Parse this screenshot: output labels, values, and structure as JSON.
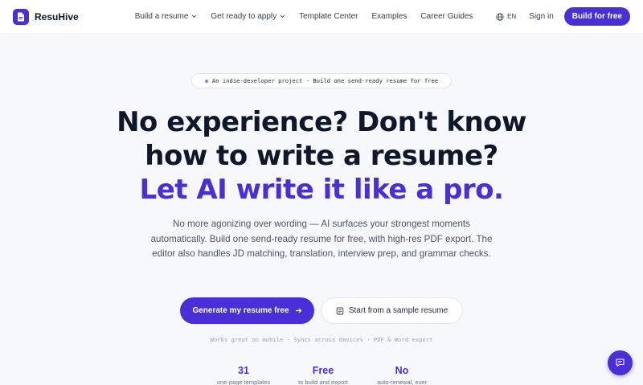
{
  "brand": {
    "name": "ResuHive",
    "logo_icon": "document-icon",
    "accent_color": "#4a2fd8"
  },
  "nav": {
    "items": [
      {
        "label": "Build a resume",
        "has_dropdown": true
      },
      {
        "label": "Get ready to apply",
        "has_dropdown": true
      },
      {
        "label": "Template Center",
        "has_dropdown": false
      },
      {
        "label": "Examples",
        "has_dropdown": false
      },
      {
        "label": "Career Guides",
        "has_dropdown": false
      }
    ],
    "language": "EN",
    "signin": "Sign in",
    "cta": "Build for free"
  },
  "hero": {
    "pill": "An indie-developer project · Build one send-ready resume for free",
    "headline_line1": "No experience? Don't know",
    "headline_line2": "how to write a resume?",
    "headline_accent": "Let AI write it like a pro.",
    "lead": "No more agonizing over wording — AI surfaces your strongest moments automatically. Build one send-ready resume for free, with high-res PDF export. The editor also handles JD matching, translation, interview prep, and grammar checks.",
    "primary_button": "Generate my resume free",
    "secondary_button": "Start from a sample resume",
    "features": "Works great on mobile · Syncs across devices · PDF & Word export"
  },
  "stats": [
    {
      "value": "31",
      "label": "one-page templates"
    },
    {
      "value": "Free",
      "label": "to build and export"
    },
    {
      "value": "No",
      "label": "auto-renewal, ever"
    }
  ]
}
